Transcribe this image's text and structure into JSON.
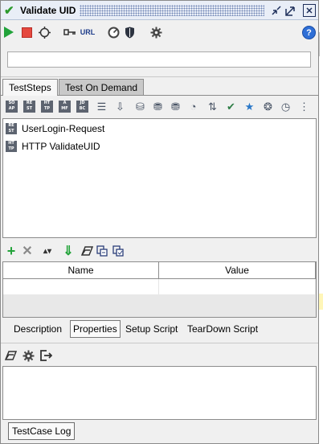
{
  "window": {
    "title": "Validate UID",
    "icons": [
      "check-icon",
      "minimize-icon",
      "maximize-icon",
      "close-icon"
    ]
  },
  "toolbar": {
    "url_label": "URL",
    "help_label": "?",
    "icons": [
      "run-icon",
      "stop-icon",
      "loop-icon",
      "credentials-icon",
      "url-icon",
      "coverage-icon",
      "security-icon",
      "settings-icon",
      "help-icon"
    ]
  },
  "search": {
    "value": "",
    "placeholder": ""
  },
  "tabs": [
    {
      "label": "TestSteps",
      "active": true
    },
    {
      "label": "Test On Demand",
      "active": false
    }
  ],
  "step_toolbar": [
    {
      "name": "soap-request-icon",
      "lines": [
        "SO",
        "AP"
      ]
    },
    {
      "name": "rest-request-icon",
      "lines": [
        "RE",
        "ST"
      ]
    },
    {
      "name": "http-request-icon",
      "lines": [
        "HT",
        "TP"
      ]
    },
    {
      "name": "amf-request-icon",
      "lines": [
        "A",
        "MF"
      ]
    },
    {
      "name": "jdbc-request-icon",
      "lines": [
        "JD",
        "BC"
      ]
    },
    {
      "name": "properties-step-icon",
      "glyph": "☰"
    },
    {
      "name": "property-transfer-icon",
      "glyph": "⇩"
    },
    {
      "name": "conditional-goto-icon",
      "glyph": "⛁"
    },
    {
      "name": "mock-response-icon",
      "glyph": "⛃"
    },
    {
      "name": "delay-step-icon",
      "glyph": "⛃"
    },
    {
      "name": "run-testcase-icon",
      "glyph": "◔"
    },
    {
      "name": "manual-step-icon",
      "glyph": "⇅"
    },
    {
      "name": "assertion-icon",
      "glyph": "✔"
    },
    {
      "name": "star-icon",
      "glyph": "★"
    },
    {
      "name": "load-icon",
      "glyph": "❂"
    },
    {
      "name": "clock-icon",
      "glyph": "◷"
    },
    {
      "name": "script-icon",
      "glyph": "⋮"
    }
  ],
  "steps": [
    {
      "label": "UserLogin-Request",
      "icon": "rest-step-icon",
      "lines": [
        "RE",
        "ST"
      ]
    },
    {
      "label": "HTTP ValidateUID",
      "icon": "http-step-icon",
      "lines": [
        "HT",
        "TP"
      ]
    }
  ],
  "properties_toolbar": {
    "icons": [
      "add-icon",
      "remove-icon",
      "move-up-down-icon",
      "move-down-icon",
      "clear-icon",
      "load-icon",
      "save-icon"
    ]
  },
  "properties_table": {
    "columns": [
      "Name",
      "Value"
    ],
    "rows": []
  },
  "bottom_tabs": [
    {
      "label": "Description",
      "selected": false
    },
    {
      "label": "Properties",
      "selected": true
    },
    {
      "label": "Setup Script",
      "selected": false
    },
    {
      "label": "TearDown Script",
      "selected": false
    }
  ],
  "log_toolbar": {
    "icons": [
      "clear-log-icon",
      "log-settings-icon",
      "export-log-icon"
    ]
  },
  "log_tab": "TestCase Log",
  "colors": {
    "accent_green": "#22a33a",
    "stop_red": "#e5493f",
    "help_blue": "#2f6fd6",
    "title_bg": "#e9eef7"
  }
}
